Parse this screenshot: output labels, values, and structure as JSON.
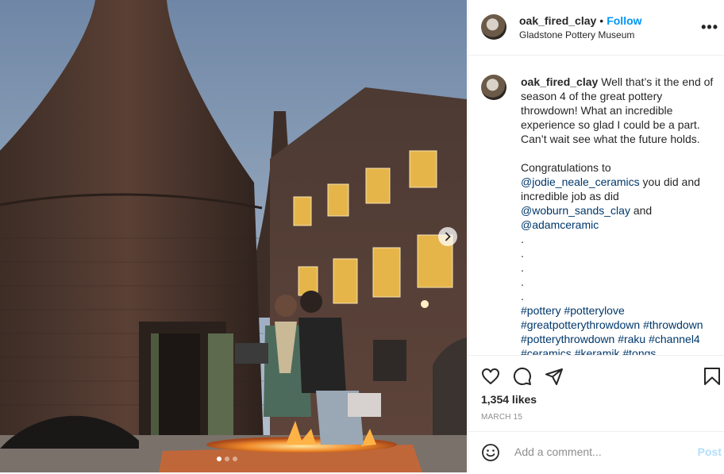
{
  "post": {
    "username": "oak_fired_clay",
    "follow_label": "Follow",
    "separator": "•",
    "location": "Gladstone Pottery Museum",
    "more_label": "•••"
  },
  "caption": {
    "username": "oak_fired_clay",
    "text": "Well that’s it the end of season 4 of the great pottery throwdown! What an incredible experience so glad I could be a part. Can’t wait see what the future holds.",
    "congrats": "Congratulations to",
    "mention1": "@jodie_neale_ceramics",
    "after_mention1": " you did and incredible job as did",
    "mention2": "@woburn_sands_clay",
    "after_mention2": " and",
    "mention3": "@adamceramic",
    "dots": [
      ".",
      ".",
      ".",
      ".",
      "."
    ],
    "hashtag_lines": [
      [
        "#pottery",
        "#potterylove"
      ],
      [
        "#greatpotterythrowdown",
        "#throwdown"
      ],
      [
        "#potterythrowdown",
        "#raku",
        "#channel4"
      ],
      [
        "#ceramics",
        "#keramik",
        "#tongs"
      ]
    ]
  },
  "engagement": {
    "likes": "1,354 likes",
    "date": "MARCH 15"
  },
  "comment_box": {
    "placeholder": "Add a comment...",
    "post_label": "Post"
  },
  "carousel": {
    "total": 3,
    "active": 0
  },
  "icons": {
    "like": "heart-icon",
    "comment": "comment-bubble-icon",
    "share": "paper-plane-icon",
    "save": "bookmark-icon",
    "emoji": "smiley-icon",
    "next": "chevron-right-icon"
  },
  "colors": {
    "link": "#00376b",
    "follow": "#0095f6",
    "post_disabled": "#b2dffc",
    "muted": "#8e8e8e"
  }
}
